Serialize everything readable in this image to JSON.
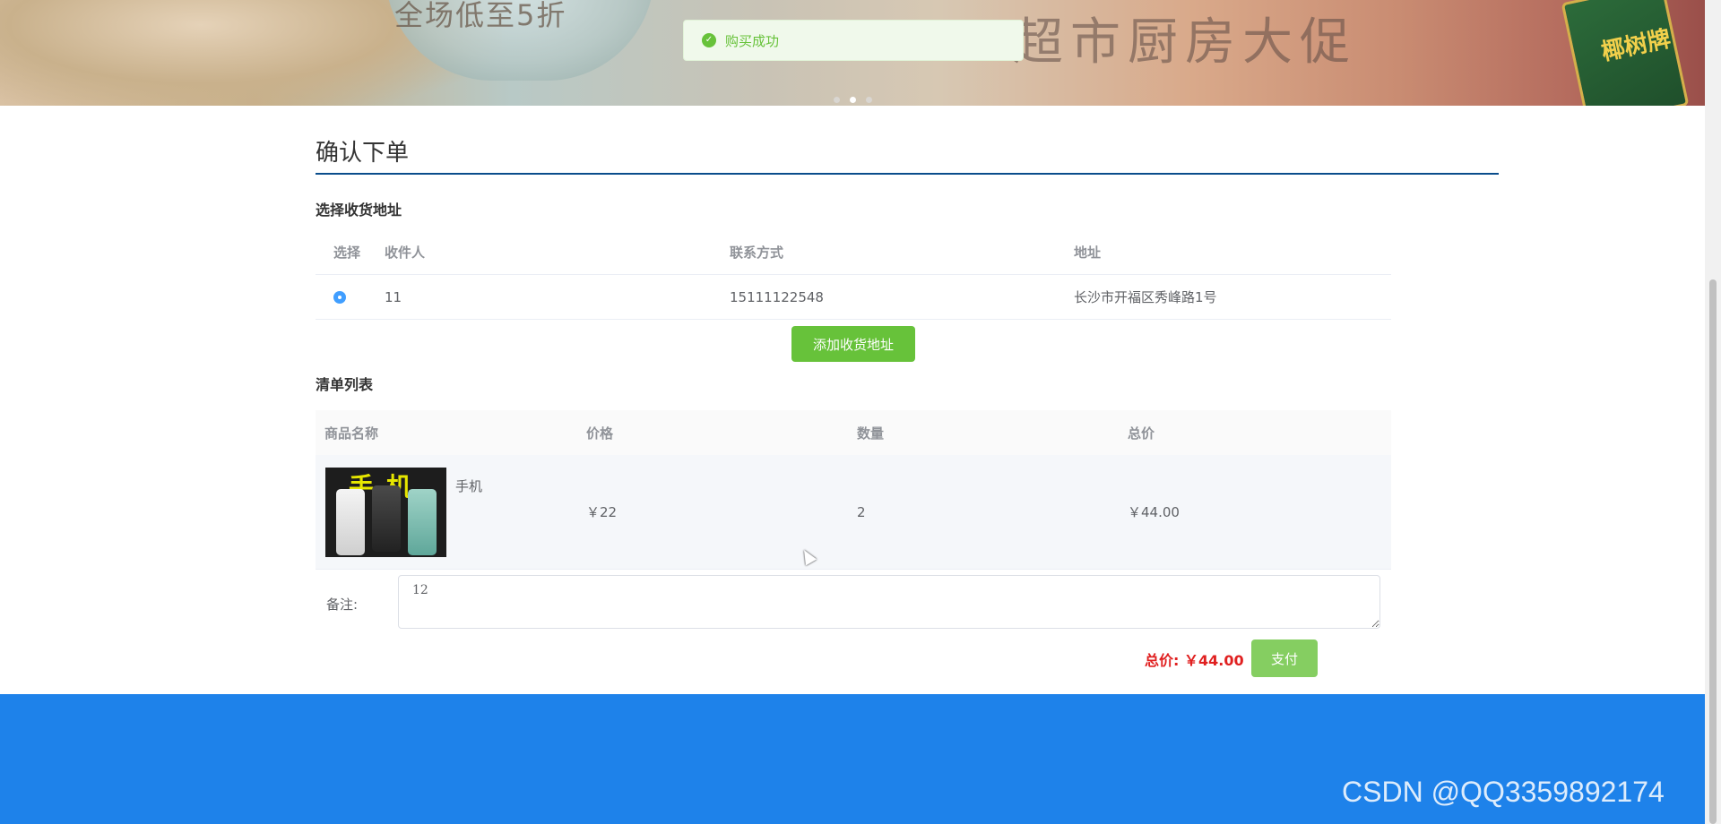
{
  "banner": {
    "slogan_left": "全场低至5折",
    "slogan_right": "超市厨房大促",
    "bag_text": "椰树牌"
  },
  "toast": {
    "message": "购买成功"
  },
  "page": {
    "title": "确认下单"
  },
  "address_section": {
    "title": "选择收货地址",
    "columns": [
      "选择",
      "收件人",
      "联系方式",
      "地址"
    ],
    "rows": [
      {
        "recipient": "11",
        "phone": "15111122548",
        "address": "长沙市开福区秀峰路1号",
        "selected": true
      }
    ],
    "add_button": "添加收货地址"
  },
  "list_section": {
    "title": "清单列表",
    "columns": [
      "商品名称",
      "价格",
      "数量",
      "总价"
    ],
    "rows": [
      {
        "image_text": "手机",
        "name": "手机",
        "price": "￥22",
        "quantity": "2",
        "subtotal": "￥44.00"
      }
    ]
  },
  "remark": {
    "label": "备注:",
    "value": "12"
  },
  "summary": {
    "total": "总价: ￥44.00",
    "pay_button": "支付"
  },
  "watermark": "CSDN @QQ3359892174",
  "colors": {
    "accent": "#1e82ea",
    "success": "#67c23a",
    "price": "#e02020"
  }
}
